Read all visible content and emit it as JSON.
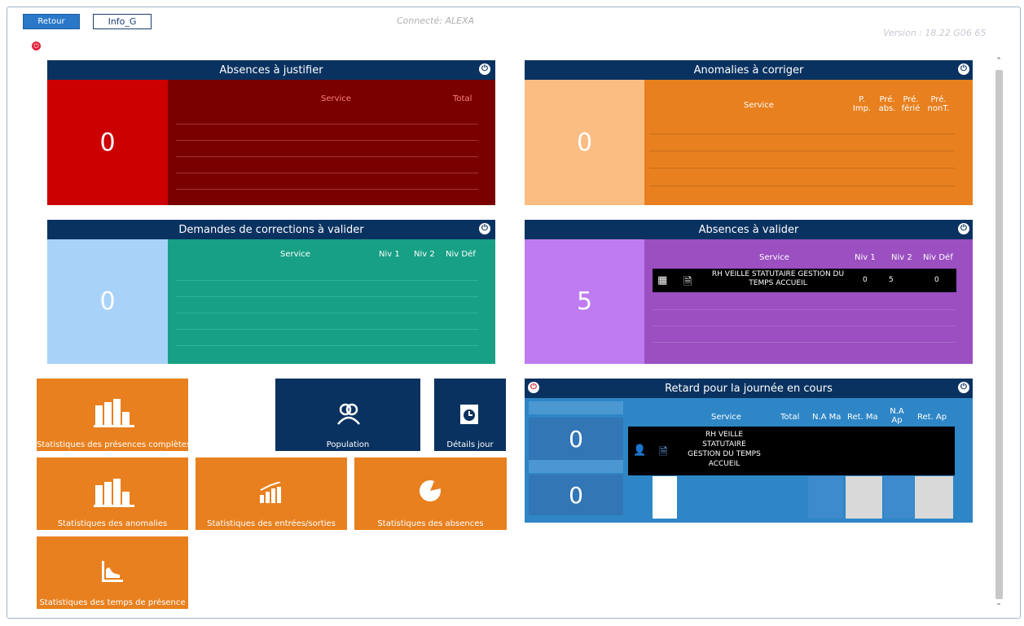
{
  "top": {
    "back_label": "Retour",
    "info_label": "Info_G",
    "connected": "Connecté: ALEXA",
    "version": "Version :   18.22 G06 65"
  },
  "panels": {
    "absences_justifier": {
      "title": "Absences à justifier",
      "count": "0",
      "headers": [
        "Service",
        "Total"
      ],
      "colors": {
        "left": "#cc0000",
        "right": "#7a0000"
      }
    },
    "anomalies": {
      "title": "Anomalies à corriger",
      "count": "0",
      "headers": [
        "Service",
        "P. Imp.",
        "Pré. abs.",
        "Pré. férié",
        "Pré. nonT."
      ],
      "colors": {
        "left": "#fbbd82",
        "right": "#e8801f"
      }
    },
    "corrections": {
      "title": "Demandes de corrections à valider",
      "count": "0",
      "headers": [
        "Service",
        "Niv 1",
        "Niv 2",
        "Niv Déf"
      ],
      "colors": {
        "left": "#a9d2f8",
        "right": "#17a085"
      }
    },
    "absences_valider": {
      "title": "Absences à valider",
      "count": "5",
      "headers": [
        "Service",
        "Niv 1",
        "Niv 2",
        "Niv Déf"
      ],
      "row": {
        "service": "RH VEILLE STATUTAIRE GESTION DU TEMPS ACCUEIL",
        "niv1": "0",
        "niv2": "5",
        "nivdef": "0"
      },
      "colors": {
        "left": "#be7cf0",
        "right": "#9b4fc1"
      }
    },
    "retard": {
      "title": "Retard pour la journée en cours",
      "count_top": "0",
      "count_bottom": "0",
      "headers": [
        "Service",
        "Total",
        "N.A Ma",
        "Ret. Ma",
        "N.A Ap",
        "Ret. Ap"
      ],
      "row": {
        "service": "RH VEILLE STATUTAIRE GESTION DU TEMPS ACCUEIL"
      },
      "colors": {
        "bg": "#2e86c6",
        "left": "#4a97d2"
      }
    }
  },
  "tiles": {
    "stats_presences": "Statistiques des présences complètes",
    "population": "Population",
    "details_jour": "Détails jour",
    "stats_anomalies": "Statistiques des anomalies",
    "stats_entrees": "Statistiques des entrées/sorties",
    "stats_absences": "Statistiques des absences",
    "stats_temps": "Statistiques des temps de présence"
  }
}
